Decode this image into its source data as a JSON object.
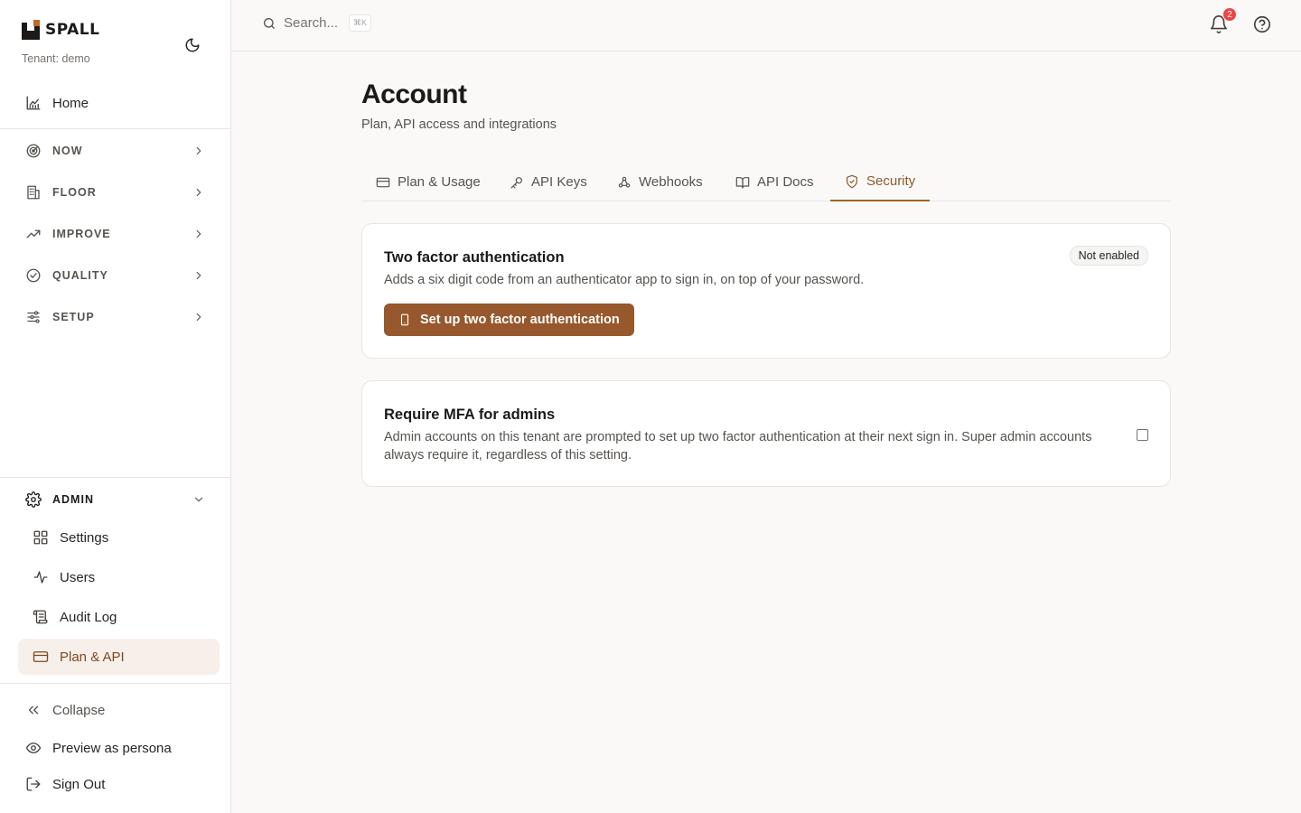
{
  "brand": {
    "logo_text": "SPALL",
    "tenant": "Tenant: demo"
  },
  "icons": {
    "theme": "moon-icon",
    "home": "chart-icon",
    "now": "radar-icon",
    "floor": "building-icon",
    "improve": "trending-up-icon",
    "quality": "check-circle-icon",
    "setup": "sliders-icon",
    "admin": "gear-icon",
    "settings": "grid-icon",
    "users": "activity-icon",
    "audit": "scroll-icon",
    "plan": "credit-card-icon",
    "collapse": "chevrons-left-icon",
    "preview": "eye-icon",
    "signout": "logout-icon",
    "search": "search-icon",
    "bell": "bell-icon",
    "help": "help-circle-icon"
  },
  "sidebar": {
    "home": "Home",
    "groups": [
      "NOW",
      "FLOOR",
      "IMPROVE",
      "QUALITY",
      "SETUP"
    ],
    "admin": {
      "label": "ADMIN",
      "items": [
        "Settings",
        "Users",
        "Audit Log",
        "Plan & API"
      ],
      "active": "Plan & API"
    },
    "footer": {
      "collapse": "Collapse",
      "preview": "Preview as persona",
      "signout": "Sign Out"
    }
  },
  "topbar": {
    "search_label": "Search...",
    "shortcut": "⌘K",
    "notification_count": "2"
  },
  "page": {
    "title": "Account",
    "subtitle": "Plan, API access and integrations"
  },
  "tabs": [
    {
      "label": "Plan & Usage",
      "icon": "credit-card-icon"
    },
    {
      "label": "API Keys",
      "icon": "key-icon"
    },
    {
      "label": "Webhooks",
      "icon": "webhook-icon"
    },
    {
      "label": "API Docs",
      "icon": "book-icon"
    },
    {
      "label": "Security",
      "icon": "shield-check-icon"
    }
  ],
  "active_tab": "Security",
  "twofa": {
    "title": "Two factor authentication",
    "status": "Not enabled",
    "description": "Adds a six digit code from an authenticator app to sign in, on top of your password.",
    "button": "Set up two factor authentication"
  },
  "mfa": {
    "title": "Require MFA for admins",
    "description_line1": "Admin accounts on this tenant are prompted to set up two factor authentication at their next sign in. Super admin accounts",
    "description_line2": "always require it, regardless of this setting.",
    "checked": false
  },
  "colors": {
    "accent": "#96582c",
    "active_bg": "#f7efe9",
    "badge": "#ef4444",
    "logo_orange": "#c2692b"
  }
}
